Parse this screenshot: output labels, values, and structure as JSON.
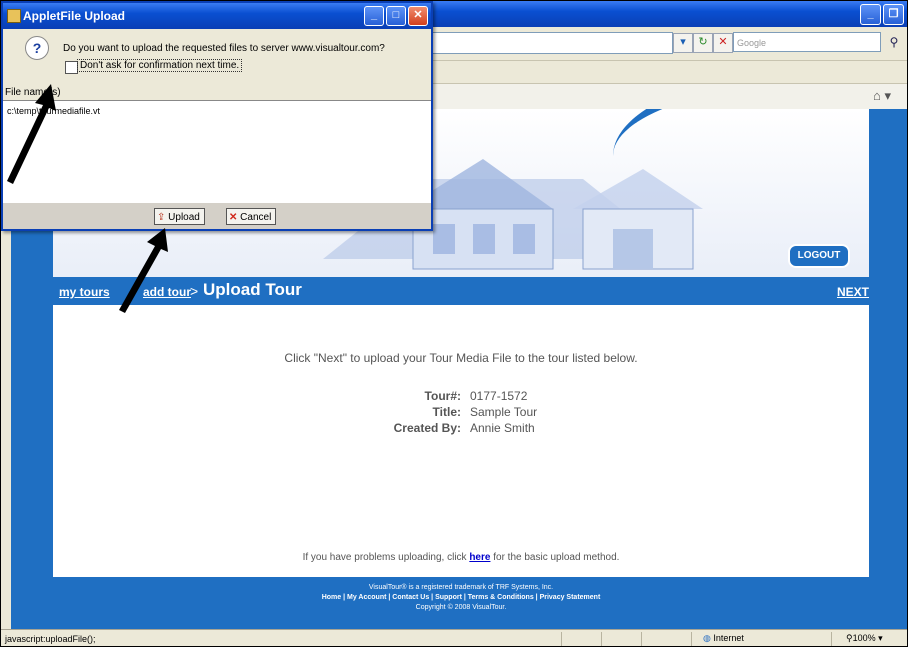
{
  "dialog": {
    "title": "AppletFile Upload",
    "question": "Do you want to upload the requested files to server www.visualtour.com?",
    "checkbox_label": "Don't ask for confirmation next time.",
    "filenames_label": "File name(s)",
    "files": [
      "c:\\temp\\tourmediafile.vt"
    ],
    "upload_label": "Upload",
    "cancel_label": "Cancel"
  },
  "browser": {
    "search_placeholder": "Google",
    "status_text": "javascript:uploadFile();",
    "zone": "Internet",
    "zoom": "100%"
  },
  "page": {
    "logout_label": "LOGOUT",
    "breadcrumb": {
      "my_tours": "my tours",
      "add_tour": "add tour",
      "separator": ">",
      "current": "Upload Tour"
    },
    "next_label": "NEXT",
    "message": "Click \"Next\" to upload your Tour Media File to the tour listed below.",
    "tour": {
      "number_label": "Tour#:",
      "number": "0177-1572",
      "title_label": "Title:",
      "title": "Sample Tour",
      "created_label": "Created By:",
      "created_by": "Annie Smith"
    },
    "problem_prefix": "If you have problems uploading, click ",
    "problem_link": "here",
    "problem_suffix": " for the basic upload method.",
    "footer": {
      "trademark": "VisualTour® is a registered trademark of TRF Systems, Inc.",
      "links": "Home | My Account | Contact Us | Support | Terms & Conditions | Privacy Statement",
      "copyright": "Copyright © 2008 VisualTour."
    }
  },
  "colors": {
    "site_blue": "#1f6fc2",
    "xp_titlebar": "#0a4fd1"
  }
}
